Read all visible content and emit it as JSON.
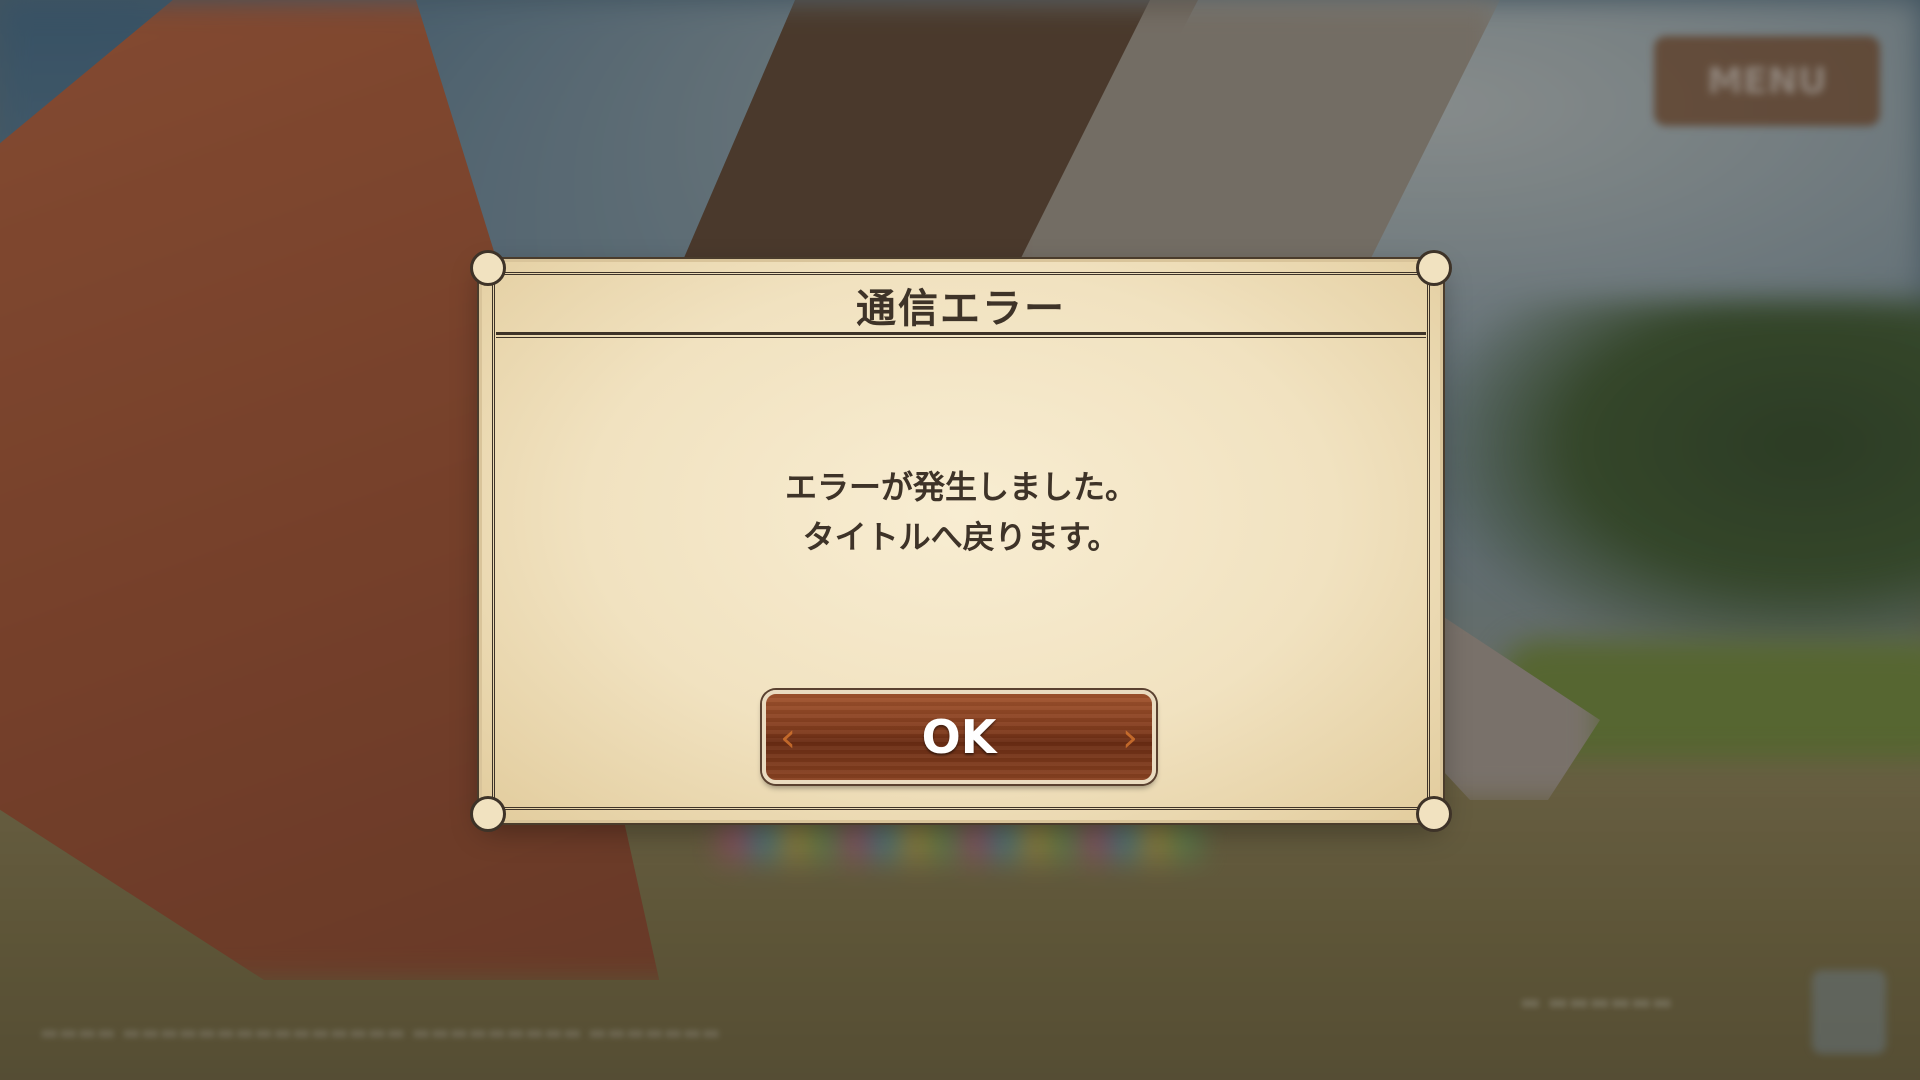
{
  "background": {
    "hud_info_line1": "",
    "hud_info_line2": "",
    "menu_label": "MENU"
  },
  "dialog": {
    "title": "通信エラー",
    "message_line1": "エラーが発生しました。",
    "message_line2": "タイトルへ戻ります。",
    "ok_label": "OK"
  },
  "colors": {
    "dialog_paper": "#f1e2c0",
    "dialog_ink": "#3e3328",
    "button_brown": "#7f3a1c",
    "button_chevron": "#d7772f"
  },
  "icons": {
    "left_chevron": "chevron-left-icon",
    "right_chevron": "chevron-right-icon"
  }
}
